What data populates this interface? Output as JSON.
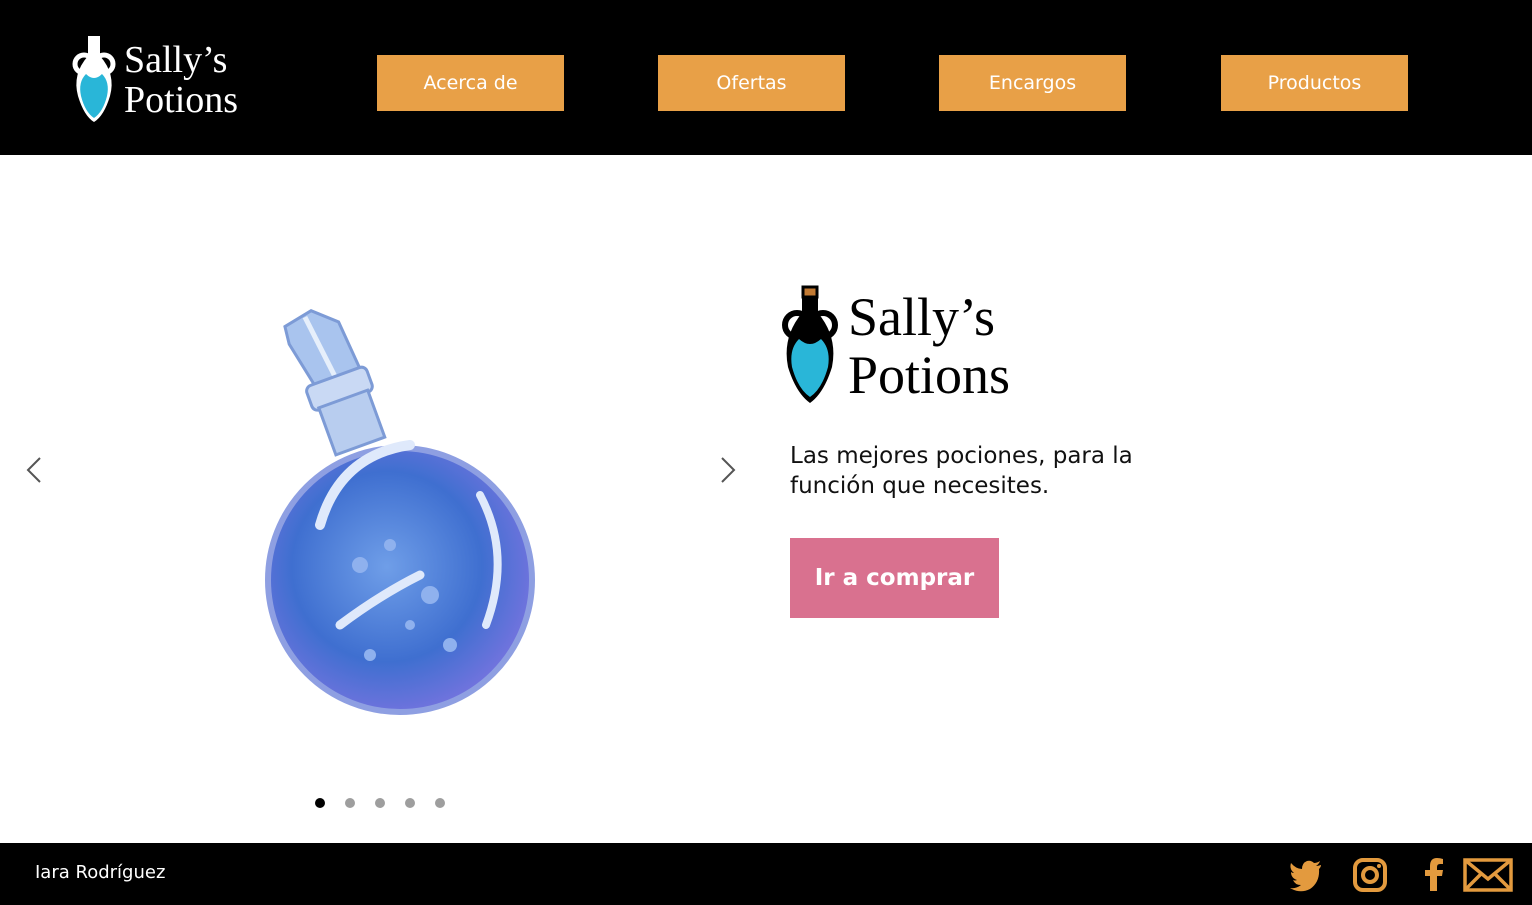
{
  "brand": {
    "line1": "Sally’s",
    "line2": "Potions"
  },
  "nav": [
    {
      "label": "Acerca de"
    },
    {
      "label": "Ofertas"
    },
    {
      "label": "Encargos"
    },
    {
      "label": "Productos"
    }
  ],
  "hero": {
    "tagline": "Las mejores pociones, para la función que necesites.",
    "cta_label": "Ir a comprar",
    "slide_count": 5,
    "active_slide": 1
  },
  "footer": {
    "author": "Iara Rodríguez"
  },
  "icons": {
    "prev": "chevron-left-icon",
    "next": "chevron-right-icon",
    "social": [
      "twitter-icon",
      "instagram-icon",
      "facebook-icon",
      "mail-icon"
    ]
  },
  "colors": {
    "nav_button": "#e8a047",
    "cta_button": "#d9718f",
    "social_icon": "#e39a3e",
    "potion_teal": "#29b6d8"
  }
}
